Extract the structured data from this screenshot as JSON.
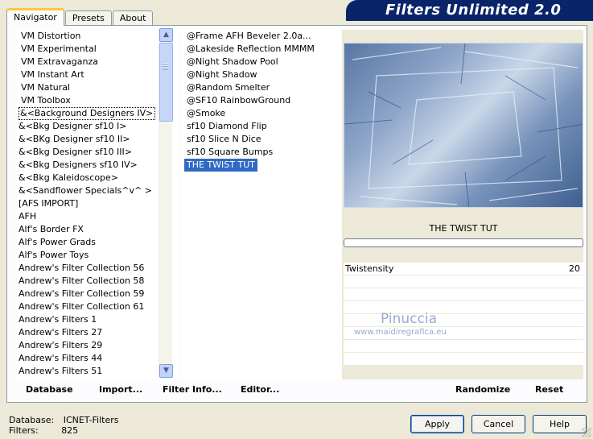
{
  "tabs": [
    "Navigator",
    "Presets",
    "About"
  ],
  "brand": "Filters Unlimited 2.0",
  "categories": [
    "VM Distortion",
    "VM Experimental",
    "VM Extravaganza",
    "VM Instant Art",
    "VM Natural",
    "VM Toolbox",
    "&<Background Designers IV>",
    "&<Bkg Designer sf10 I>",
    "&<BKg Designer sf10 II>",
    "&<Bkg Designer sf10 III>",
    "&<Bkg Designers sf10 IV>",
    "&<Bkg Kaleidoscope>",
    "&<Sandflower Specials^v^ >",
    "[AFS IMPORT]",
    "AFH",
    "Alf's Border FX",
    "Alf's Power Grads",
    "Alf's Power Toys",
    "Andrew's Filter Collection 56",
    "Andrew's Filter Collection 58",
    "Andrew's Filter Collection 59",
    "Andrew's Filter Collection 61",
    "Andrew's Filters 1",
    "Andrew's Filters 27",
    "Andrew's Filters 29",
    "Andrew's Filters 44",
    "Andrew's Filters 51"
  ],
  "filters": [
    "@Frame AFH Beveler 2.0a...",
    "@Lakeside Reflection MMMM",
    "@Night Shadow Pool",
    "@Night Shadow",
    "@Random Smelter",
    "@SF10 RainbowGround",
    "@Smoke",
    "sf10 Diamond Flip",
    "sf10 Slice N Dice",
    "sf10 Square Bumps",
    "THE TWIST TUT"
  ],
  "selected_filter": "THE TWIST TUT",
  "param": {
    "label": "Twistensity",
    "value": "20"
  },
  "watermark": {
    "line1": "Pinuccia",
    "line2": "www.maidiregrafica.eu"
  },
  "toolbar": {
    "database": "Database",
    "import": "Import...",
    "filter_info": "Filter Info...",
    "editor": "Editor...",
    "randomize": "Randomize",
    "reset": "Reset"
  },
  "status": {
    "database_label": "Database:",
    "database_value": "ICNET-Filters",
    "filters_label": "Filters:",
    "filters_value": "825"
  },
  "buttons": {
    "apply": "Apply",
    "cancel": "Cancel",
    "help": "Help"
  }
}
